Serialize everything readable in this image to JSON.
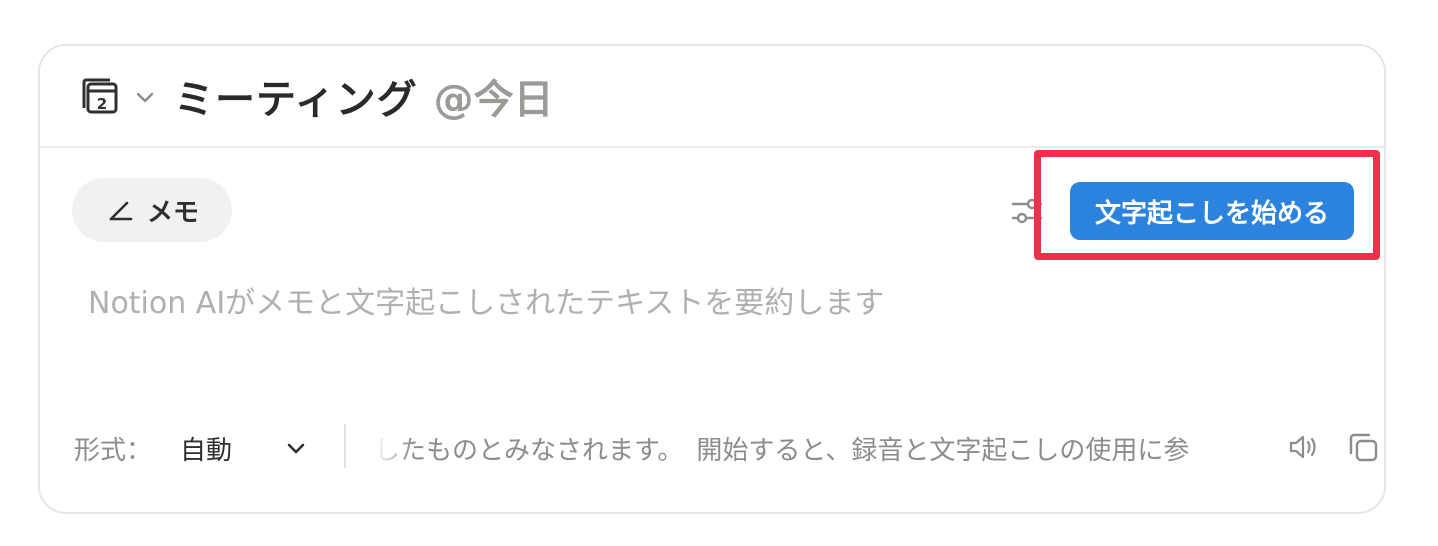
{
  "header": {
    "title": "ミーティング",
    "date": "@今日",
    "icon": "calendar-icon"
  },
  "toolbar": {
    "memo_label": "メモ",
    "start_transcription_label": "文字起こしを始める"
  },
  "editor": {
    "placeholder": "Notion AIがメモと文字起こしされたテキストを要約します"
  },
  "footer": {
    "format_label": "形式：",
    "format_value": "自動",
    "notice_text": "したものとみなされます。　開始すると、録音と文字起こしの使用に参"
  },
  "colors": {
    "accent": "#2b83dd",
    "highlight": "#f0304a"
  }
}
